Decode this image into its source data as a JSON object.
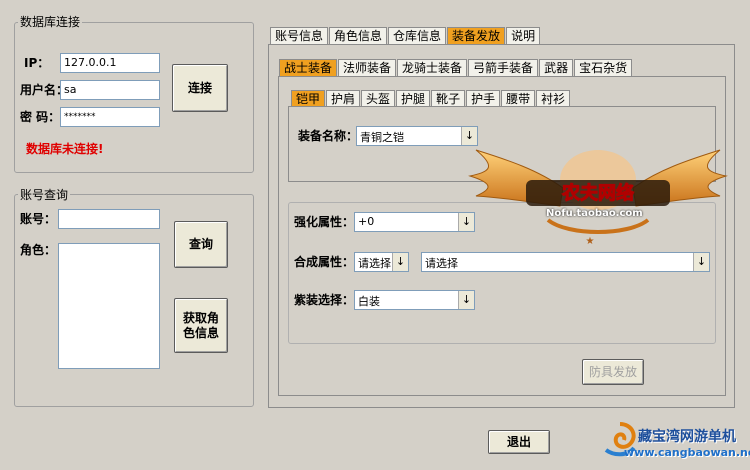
{
  "db": {
    "group_title": "数据库连接",
    "ip_label": "IP：",
    "ip_value": "127.0.0.1",
    "user_label": "用户名：",
    "user_value": "sa",
    "pwd_label": "密 码：",
    "pwd_value": "*******",
    "connect_button": "连接",
    "status": "数据库未连接!",
    "status_color": "#e00000"
  },
  "account": {
    "group_title": "账号查询",
    "account_label": "账号：",
    "account_value": "",
    "role_label": "角色：",
    "query_button": "查询",
    "get_role_button": "获取角色信息"
  },
  "main_tabs": [
    {
      "label": "账号信息",
      "active": false
    },
    {
      "label": "角色信息",
      "active": false
    },
    {
      "label": "仓库信息",
      "active": false
    },
    {
      "label": "装备发放",
      "active": true
    },
    {
      "label": "说明",
      "active": false
    }
  ],
  "class_tabs": [
    {
      "label": "战士装备",
      "active": true
    },
    {
      "label": "法师装备",
      "active": false
    },
    {
      "label": "龙骑士装备",
      "active": false
    },
    {
      "label": "弓箭手装备",
      "active": false
    },
    {
      "label": "武器",
      "active": false
    },
    {
      "label": "宝石杂货",
      "active": false
    }
  ],
  "slot_tabs": [
    {
      "label": "铠甲",
      "active": true
    },
    {
      "label": "护肩",
      "active": false
    },
    {
      "label": "头盔",
      "active": false
    },
    {
      "label": "护腿",
      "active": false
    },
    {
      "label": "靴子",
      "active": false
    },
    {
      "label": "护手",
      "active": false
    },
    {
      "label": "腰带",
      "active": false
    },
    {
      "label": "衬衫",
      "active": false
    }
  ],
  "equip": {
    "name_label": "装备名称：",
    "name_value": "青铜之铠",
    "enhance_label": "强化属性：",
    "enhance_value": "+0",
    "synth_label": "合成属性：",
    "synth_value1": "请选择",
    "synth_value2": "请选择",
    "set_label": "紫装选择：",
    "set_value": "白装",
    "issue_button": "防具发放"
  },
  "watermark": {
    "text": "Nofu.taobao.com"
  },
  "exit_button": "退出",
  "footer_logo": {
    "line1": "藏宝湾网游单机",
    "line2": "www.cangbaowan.net"
  },
  "icons": {
    "dropdown": "chevron-down-icon",
    "wings": "wings-logo",
    "logo": "swirl-logo-icon"
  }
}
